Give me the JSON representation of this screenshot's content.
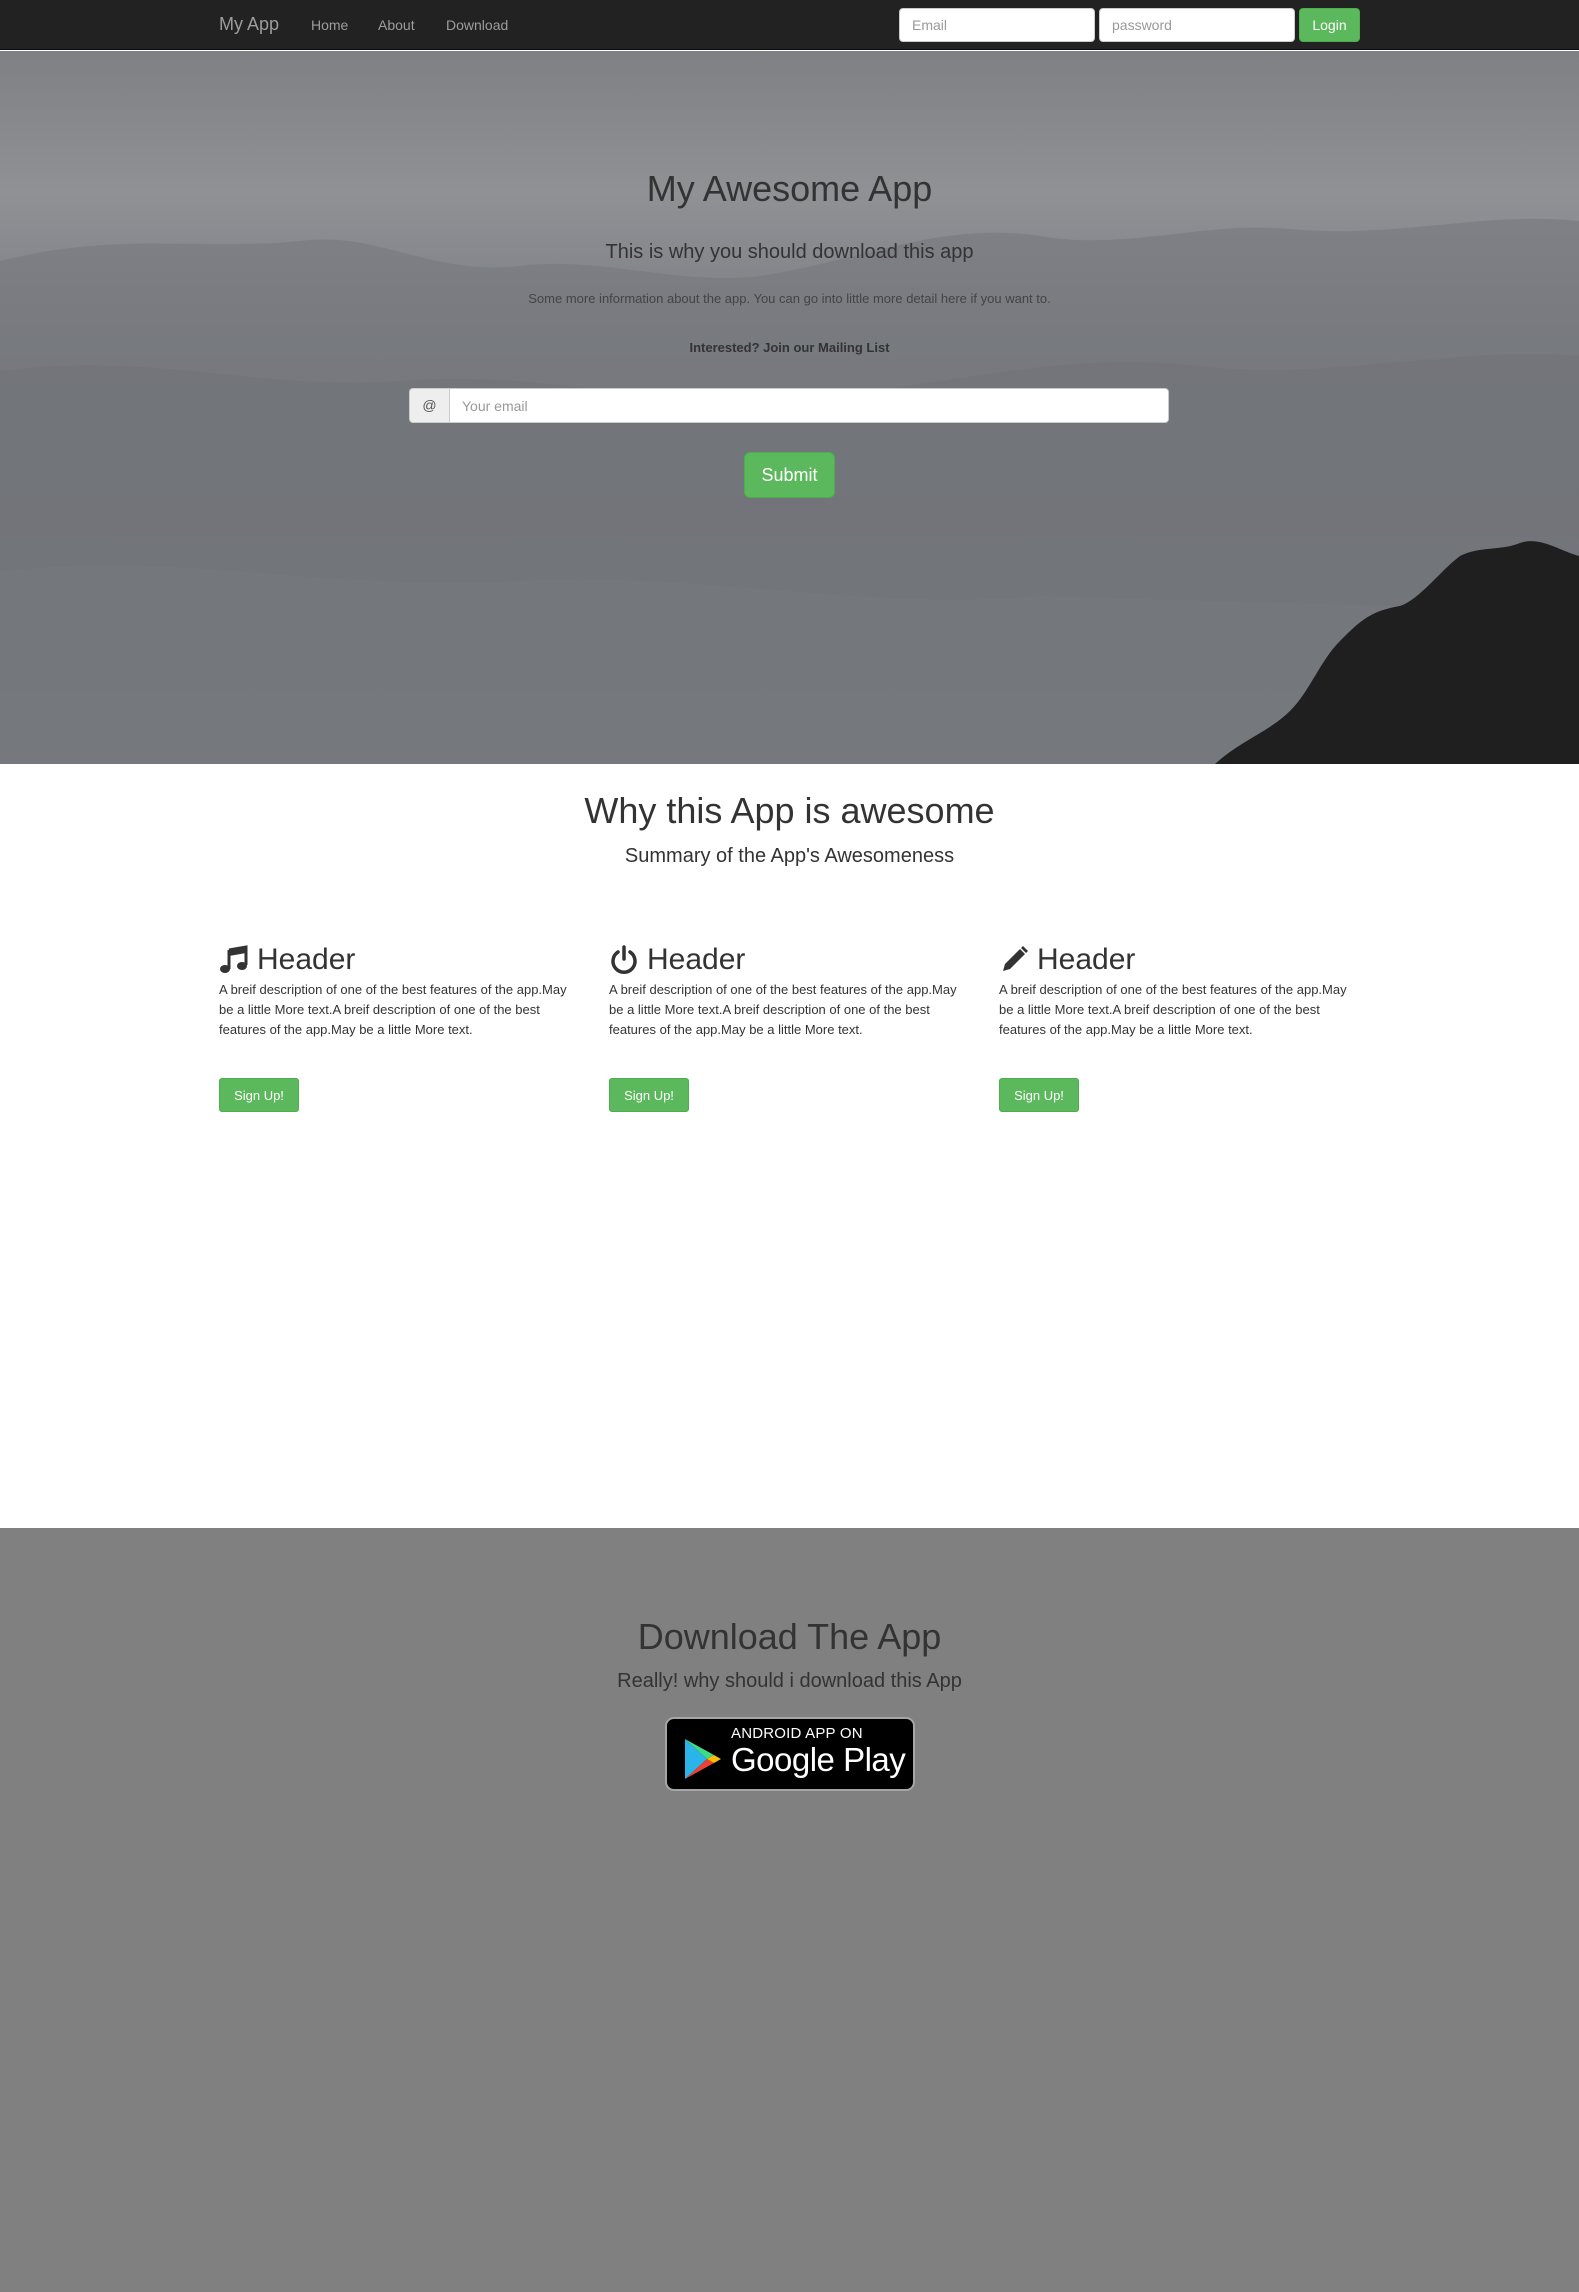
{
  "navbar": {
    "brand": "My App",
    "links": [
      "Home",
      "About",
      "Download"
    ],
    "email_placeholder": "Email",
    "password_placeholder": "password",
    "login_label": "Login"
  },
  "hero": {
    "title": "My Awesome App",
    "subtitle": "This is why you should download this app",
    "text": "Some more information about the app. You can go into little more detail here if you want to.",
    "mailing_label": "Interested? Join our Mailing List",
    "addon": "@",
    "email_placeholder": "Your email",
    "submit_label": "Submit"
  },
  "features": {
    "title": "Why this App is awesome",
    "subtitle": "Summary of the App's Awesomeness",
    "items": [
      {
        "icon": "music-icon",
        "header": "Header",
        "text": "A breif description of one of the best features of the app.May be a little More text.A breif description of one of the best features of the app.May be a little More text.",
        "button": "Sign Up!"
      },
      {
        "icon": "power-icon",
        "header": "Header",
        "text": "A breif description of one of the best features of the app.May be a little More text.A breif description of one of the best features of the app.May be a little More text.",
        "button": "Sign Up!"
      },
      {
        "icon": "pencil-icon",
        "header": "Header",
        "text": "A breif description of one of the best features of the app.May be a little More text.A breif description of one of the best features of the app.May be a little More text.",
        "button": "Sign Up!"
      }
    ]
  },
  "download": {
    "title": "Download The App",
    "subtitle": "Really! why should i download this App",
    "badge_small": "ANDROID APP ON",
    "badge_big": "Google Play"
  },
  "colors": {
    "accent": "#5cb85c",
    "navbar": "#222222",
    "download_bg": "#808080"
  }
}
